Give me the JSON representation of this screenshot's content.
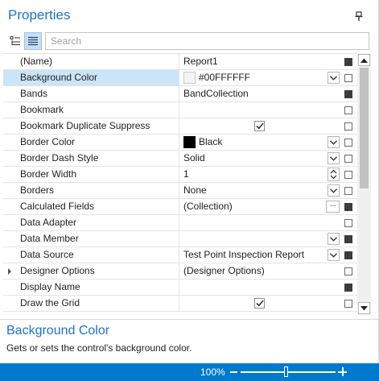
{
  "panel": {
    "title": "Properties"
  },
  "toolbar": {
    "categorized_icon": "categorized-view-icon",
    "alphabetical_icon": "alphabetical-view-icon",
    "search_placeholder": "Search"
  },
  "grid": {
    "selected_index": 1,
    "rows": [
      {
        "name": "(Name)",
        "value": "Report1",
        "editor": "none",
        "marker": "filled"
      },
      {
        "name": "Background Color",
        "value": "#00FFFFFF",
        "editor": "dropdown",
        "swatch": "#FFFFFF",
        "marker": "empty"
      },
      {
        "name": "Bands",
        "value": "BandCollection",
        "editor": "none",
        "marker": "filled"
      },
      {
        "name": "Bookmark",
        "value": "",
        "editor": "none",
        "marker": "empty"
      },
      {
        "name": "Bookmark Duplicate Suppress",
        "value": "",
        "editor": "checkbox",
        "checked": true,
        "marker": "empty"
      },
      {
        "name": "Border Color",
        "value": "Black",
        "editor": "dropdown",
        "swatch": "#000000",
        "marker": "empty"
      },
      {
        "name": "Border Dash Style",
        "value": "Solid",
        "editor": "dropdown",
        "marker": "empty"
      },
      {
        "name": "Border Width",
        "value": "1",
        "editor": "spin",
        "marker": "empty"
      },
      {
        "name": "Borders",
        "value": "None",
        "editor": "dropdown",
        "marker": "empty"
      },
      {
        "name": "Calculated Fields",
        "value": "(Collection)",
        "editor": "ellipsis",
        "marker": "filled"
      },
      {
        "name": "Data Adapter",
        "value": "",
        "editor": "none",
        "marker": "empty"
      },
      {
        "name": "Data Member",
        "value": "",
        "editor": "dropdown",
        "marker": "filled"
      },
      {
        "name": "Data Source",
        "value": "Test Point Inspection Report",
        "editor": "dropdown",
        "marker": "filled"
      },
      {
        "name": "Designer Options",
        "value": "(Designer Options)",
        "editor": "none",
        "expandable": true,
        "marker": "empty"
      },
      {
        "name": "Display Name",
        "value": "",
        "editor": "none",
        "marker": "filled"
      },
      {
        "name": "Draw the Grid",
        "value": "",
        "editor": "checkbox",
        "checked": true,
        "marker": "empty"
      }
    ]
  },
  "description": {
    "title": "Background Color",
    "text": "Gets or sets the control's background color."
  },
  "status": {
    "zoom": "100%",
    "zoom_level_fraction": 0.48
  },
  "colors": {
    "accent": "#1F72C6",
    "status_bar": "#007ACC",
    "selection": "#CCE4F7"
  }
}
